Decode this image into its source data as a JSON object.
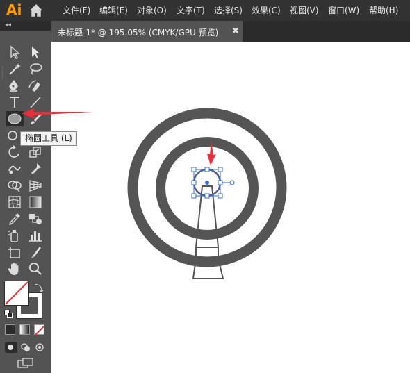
{
  "app": {
    "logo": "Ai"
  },
  "menu": [
    "文件(F)",
    "编辑(E)",
    "对象(O)",
    "文字(T)",
    "选择(S)",
    "效果(C)",
    "视图(V)",
    "窗口(W)",
    "帮助(H)"
  ],
  "panel": {
    "collapse_glyph": "◂◂"
  },
  "document_tab": {
    "title": "未标题-1* @ 195.05% (CMYK/GPU 预览)",
    "close_glyph": "✖"
  },
  "tooltip": {
    "text": "椭圆工具 (L)"
  },
  "tools": [
    "selection-tool",
    "direct-selection-tool",
    "magic-wand-tool",
    "lasso-tool",
    "pen-tool",
    "curvature-tool",
    "type-tool",
    "line-segment-tool",
    "ellipse-tool",
    "paintbrush-tool",
    "shaper-tool",
    "eraser-tool",
    "rotate-tool",
    "scale-tool",
    "warp-tool",
    "puppet-warp-tool",
    "shape-builder-tool",
    "perspective-grid-tool",
    "mesh-tool",
    "gradient-tool",
    "eyedropper-tool",
    "blend-tool",
    "symbol-sprayer-tool",
    "column-graph-tool",
    "artboard-tool",
    "slice-tool",
    "hand-tool",
    "zoom-tool"
  ],
  "colors": {
    "menubar_bg": "#323232",
    "panel_bg": "#535353",
    "artwork_gray": "#555555",
    "selection_blue": "#3a68d8",
    "annotation_red": "#e8303a"
  },
  "canvas": {
    "outer_ring": "gray ring",
    "inner_ring": "gray ring",
    "selected_shape": "small circle (selected)",
    "tower": "tapered tower stand"
  }
}
